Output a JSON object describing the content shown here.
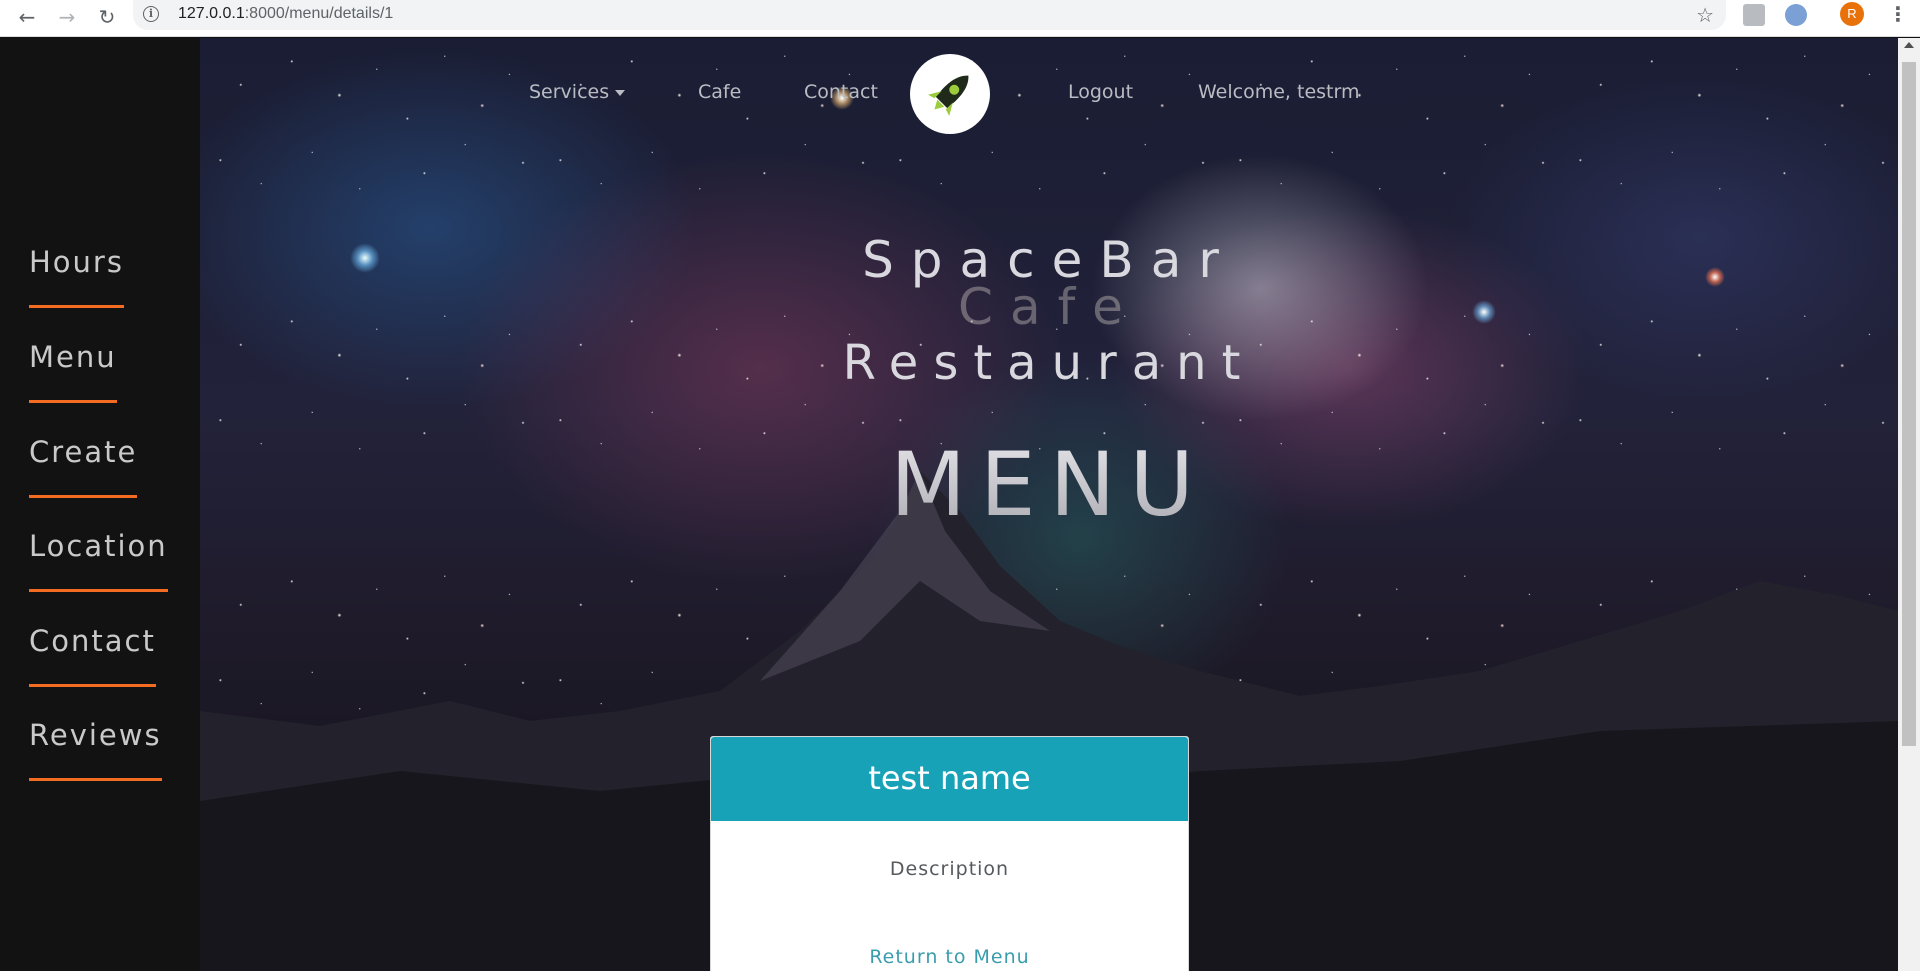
{
  "browser": {
    "url_host": "127.0.0.1",
    "url_path": ":8000/menu/details/1",
    "profile_initial": "R",
    "icons": [
      "back-arrow-icon",
      "forward-arrow-icon",
      "reload-icon",
      "info-icon",
      "star-icon",
      "menu-dots-icon"
    ]
  },
  "topnav": {
    "services": "Services",
    "cafe": "Cafe",
    "contact": "Contact",
    "logout": "Logout",
    "welcome": "Welcome, testrm",
    "logo_icon": "rocket-icon"
  },
  "sidebar": {
    "items": [
      {
        "label": "Hours"
      },
      {
        "label": "Menu"
      },
      {
        "label": "Create"
      },
      {
        "label": "Location"
      },
      {
        "label": "Contact"
      },
      {
        "label": "Reviews"
      }
    ],
    "accent_color": "#f36c21"
  },
  "hero": {
    "line1": "SpaceBar",
    "line2": "Cafe",
    "line3": "Restaurant",
    "heading": "MENU"
  },
  "card": {
    "name": "test name",
    "description": "Description",
    "link": "Return to Menu",
    "header_color": "#17a2b8"
  }
}
